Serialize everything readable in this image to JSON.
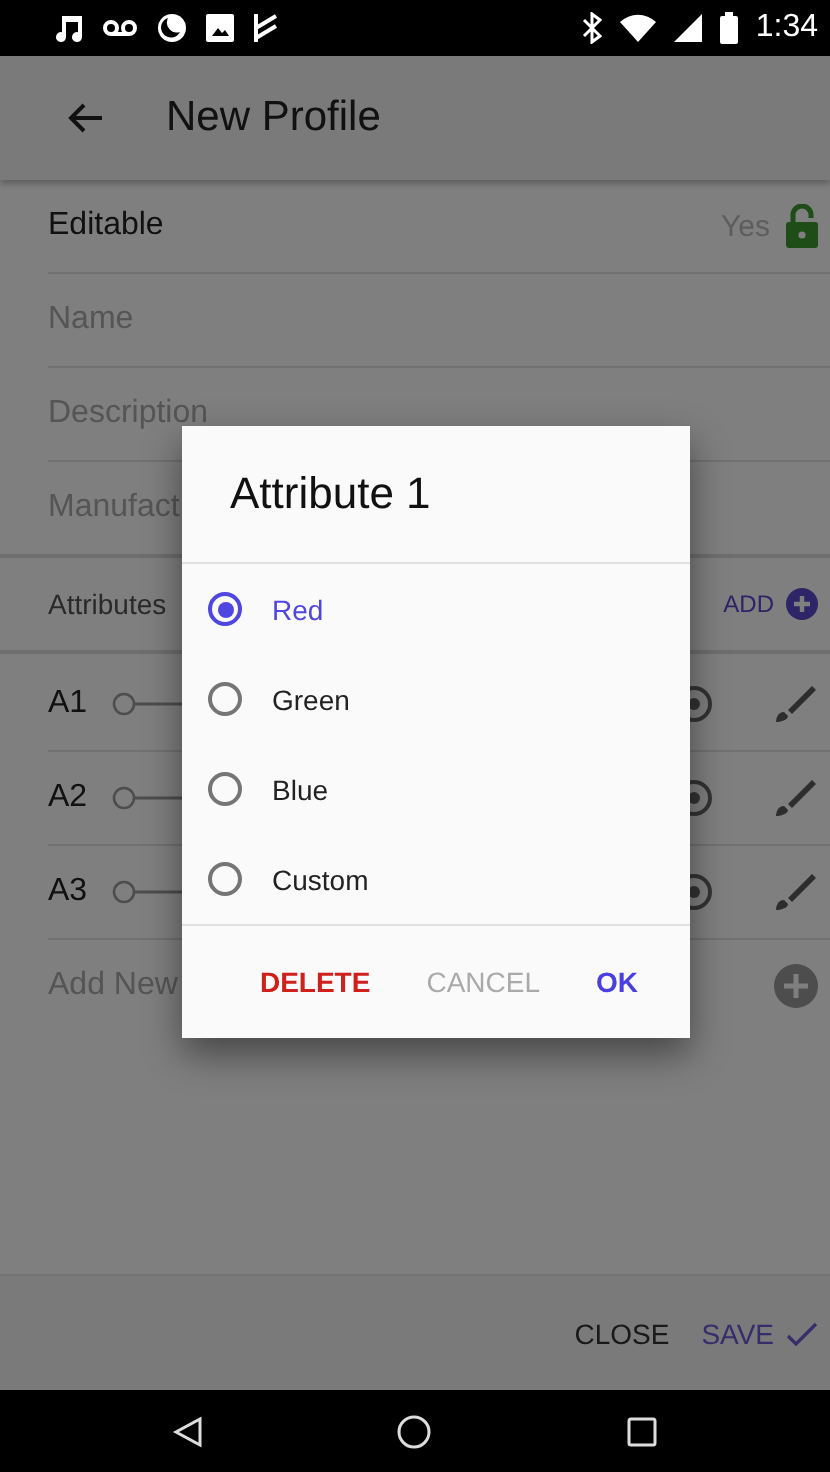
{
  "status_bar": {
    "time": "1:34"
  },
  "app_bar": {
    "title": "New Profile"
  },
  "form": {
    "editable": {
      "label": "Editable",
      "value": "Yes",
      "locked": false
    },
    "fields": [
      {
        "placeholder": "Name"
      },
      {
        "placeholder": "Description"
      },
      {
        "placeholder": "Manufact"
      }
    ]
  },
  "attributes": {
    "label": "Attributes",
    "add": "ADD",
    "add_new": "Add New",
    "rows": [
      {
        "label": "A1"
      },
      {
        "label": "A2"
      },
      {
        "label": "A3"
      }
    ]
  },
  "footer": {
    "buttons": [
      {
        "label": "CLOSE",
        "kind": "close"
      },
      {
        "label": "SAVE",
        "kind": "save"
      }
    ]
  },
  "dialog": {
    "title": "Attribute 1",
    "options": [
      {
        "label": "Red",
        "selected": true
      },
      {
        "label": "Green",
        "selected": false
      },
      {
        "label": "Blue",
        "selected": false
      },
      {
        "label": "Custom",
        "selected": false
      }
    ],
    "buttons": [
      {
        "label": "DELETE",
        "kind": "danger"
      },
      {
        "label": "CANCEL",
        "kind": "muted"
      },
      {
        "label": "OK",
        "kind": "primary"
      }
    ]
  }
}
